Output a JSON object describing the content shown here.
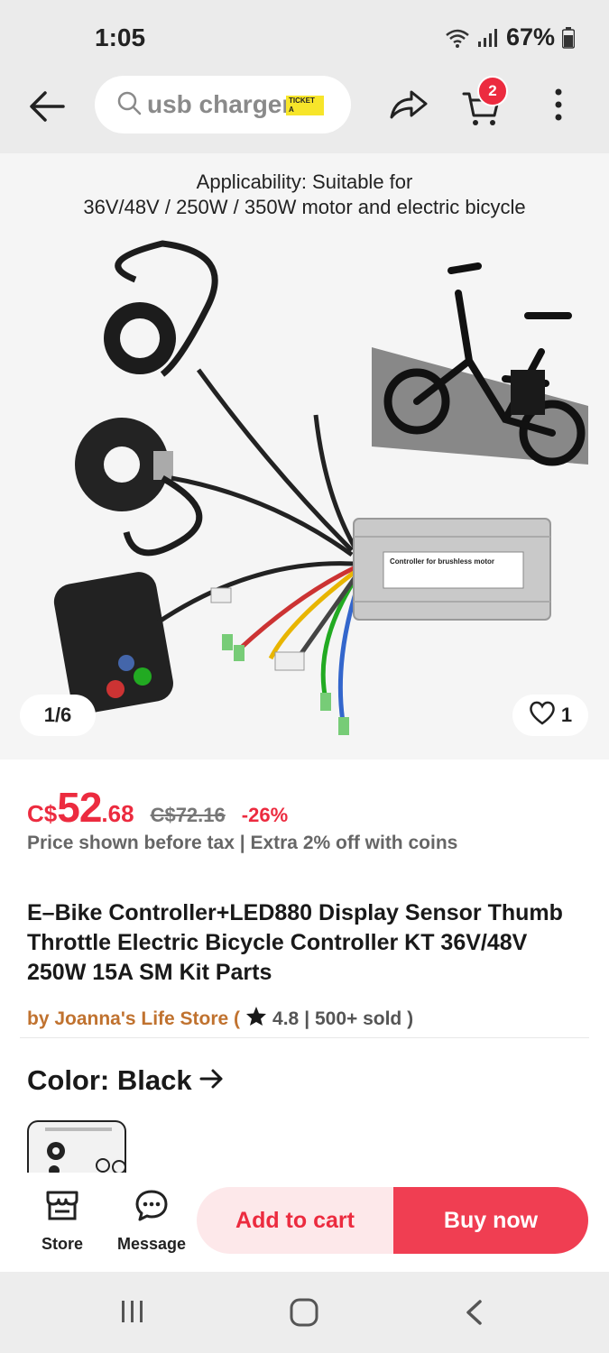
{
  "status": {
    "time": "1:05",
    "battery": "67%"
  },
  "nav": {
    "search_query": "usb charger",
    "ticket_text": "TICKET A",
    "cart_count": "2"
  },
  "gallery": {
    "caption_line1": "Applicability: Suitable for",
    "caption_line2": "36V/48V / 250W / 350W motor and electric bicycle",
    "controller_label": "Controller for brushless motor",
    "counter": "1/6",
    "likes": "1"
  },
  "price": {
    "currency": "C$",
    "integer": "52",
    "decimal": ".68",
    "original": "C$72.16",
    "discount": "-26%",
    "tax_note": "Price shown before tax | Extra 2% off with coins"
  },
  "product": {
    "title": "E–Bike Controller+LED880 Display Sensor Thumb Throttle Electric Bicycle Controller KT 36V/48V 250W 15A SM Kit Parts",
    "store_prefix": "by Joanna's Life Store (",
    "rating": "4.8",
    "sold": "| 500+ sold )",
    "color_label": "Color: Black"
  },
  "actions": {
    "store": "Store",
    "message": "Message",
    "add_to_cart": "Add to cart",
    "buy_now": "Buy now"
  },
  "colors": {
    "accent": "#ec2b3f",
    "store": "#c0722f"
  }
}
